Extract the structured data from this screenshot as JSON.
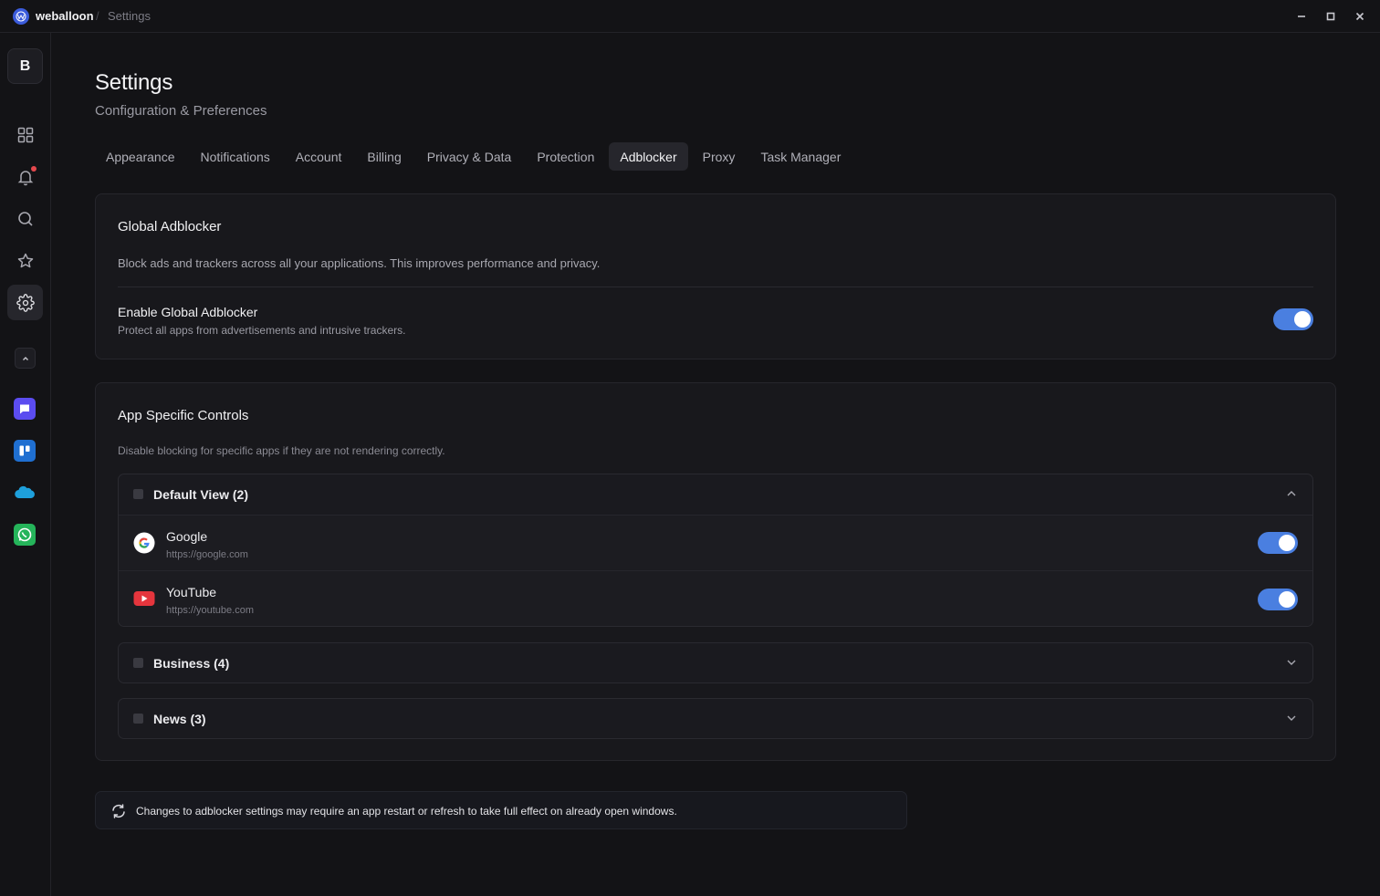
{
  "window": {
    "app_name": "weballoon",
    "separator": "/",
    "breadcrumb": "Settings"
  },
  "sidebar": {
    "workspace_initial": "B",
    "nav": [
      {
        "icon": "grid-icon"
      },
      {
        "icon": "bell-icon",
        "has_badge": true
      },
      {
        "icon": "search-icon"
      },
      {
        "icon": "star-icon"
      },
      {
        "icon": "gear-icon",
        "active": true
      }
    ],
    "apps": [
      {
        "icon": "chat-app-icon",
        "color": "#5b4cf0"
      },
      {
        "icon": "trello-icon",
        "color": "#1f6fd1"
      },
      {
        "icon": "salesforce-icon",
        "color": "#1ea0dc"
      },
      {
        "icon": "whatsapp-icon",
        "color": "#25b45a"
      }
    ]
  },
  "header": {
    "title": "Settings",
    "subtitle": "Configuration & Preferences"
  },
  "tabs": [
    {
      "label": "Appearance"
    },
    {
      "label": "Notifications"
    },
    {
      "label": "Account"
    },
    {
      "label": "Billing"
    },
    {
      "label": "Privacy & Data"
    },
    {
      "label": "Protection"
    },
    {
      "label": "Adblocker",
      "active": true
    },
    {
      "label": "Proxy"
    },
    {
      "label": "Task Manager"
    }
  ],
  "global": {
    "title": "Global Adblocker",
    "description": "Block ads and trackers across all your applications. This improves performance and privacy.",
    "enable_label": "Enable Global Adblocker",
    "enable_desc": "Protect all apps from advertisements and intrusive trackers.",
    "enabled": true
  },
  "app_controls": {
    "title": "App Specific Controls",
    "description": "Disable blocking for specific apps if they are not rendering correctly.",
    "groups": [
      {
        "label": "Default View (2)",
        "expanded": true,
        "apps": [
          {
            "name": "Google",
            "url": "https://google.com",
            "icon": "google-icon",
            "enabled": true
          },
          {
            "name": "YouTube",
            "url": "https://youtube.com",
            "icon": "youtube-icon",
            "enabled": true
          }
        ]
      },
      {
        "label": "Business (4)",
        "expanded": false
      },
      {
        "label": "News (3)",
        "expanded": false
      }
    ]
  },
  "notice": {
    "text": "Changes to adblocker settings may require an app restart or refresh to take full effect on already open windows.",
    "icon": "refresh-icon"
  },
  "colors": {
    "accent": "#4a7fe0",
    "badge": "#e5484d"
  }
}
